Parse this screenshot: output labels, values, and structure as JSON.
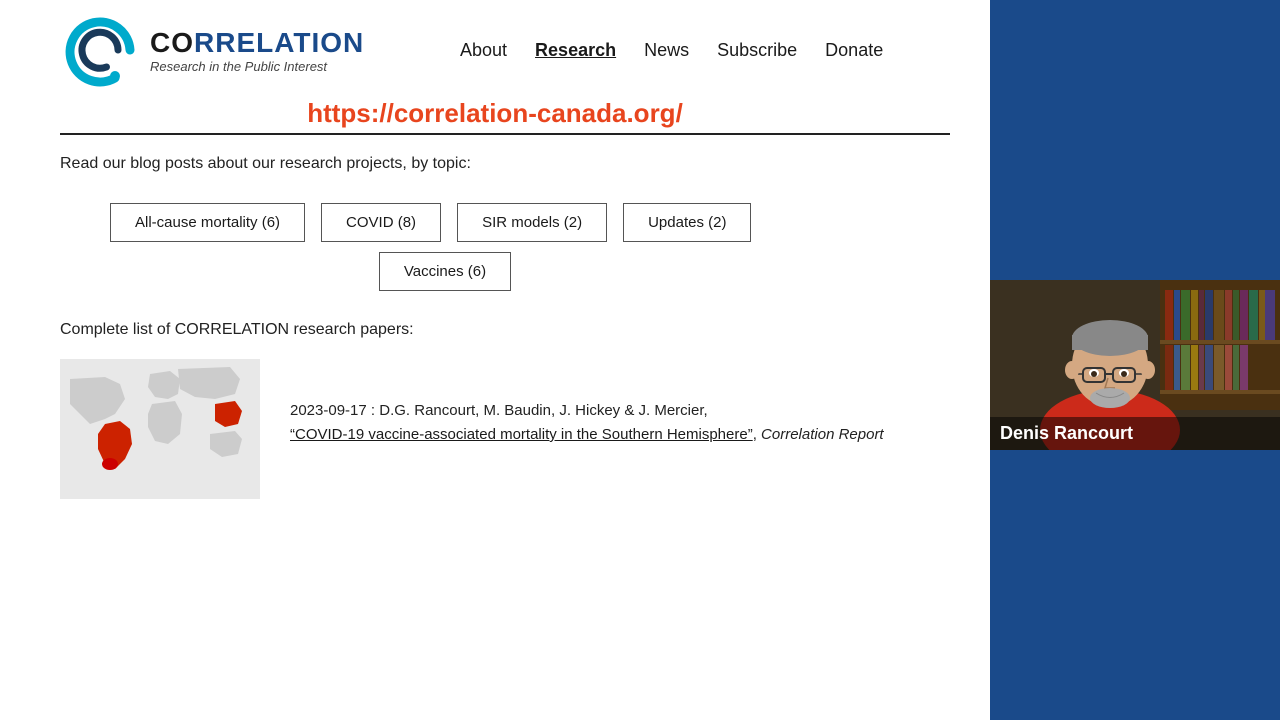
{
  "header": {
    "logo": {
      "brand": "CORRELATION",
      "subtitle": "Research in the Public Interest"
    },
    "url": "https://correlation-canada.org/",
    "nav": {
      "items": [
        {
          "label": "About",
          "active": false
        },
        {
          "label": "Research",
          "active": true
        },
        {
          "label": "News",
          "active": false
        },
        {
          "label": "Subscribe",
          "active": false
        },
        {
          "label": "Donate",
          "active": false
        }
      ]
    }
  },
  "main": {
    "blog_intro": "Read our blog posts about our research projects, by topic:",
    "topics": [
      {
        "label": "All-cause mortality (6)"
      },
      {
        "label": "COVID (8)"
      },
      {
        "label": "SIR models (2)"
      },
      {
        "label": "Updates (2)"
      },
      {
        "label": "Vaccines (6)"
      }
    ],
    "papers_intro": "Complete list of CORRELATION research papers:",
    "papers": [
      {
        "date": "2023-09-17",
        "authors": "D.G. Rancourt, M. Baudin, J. Hickey & J. Mercier,",
        "title": "“COVID-19 vaccine-associated mortality in the Southern Hemisphere”",
        "publication": "Correlation Report"
      }
    ]
  },
  "video": {
    "person_name": "Denis Rancourt"
  },
  "icons": {
    "c_logo": "C"
  }
}
